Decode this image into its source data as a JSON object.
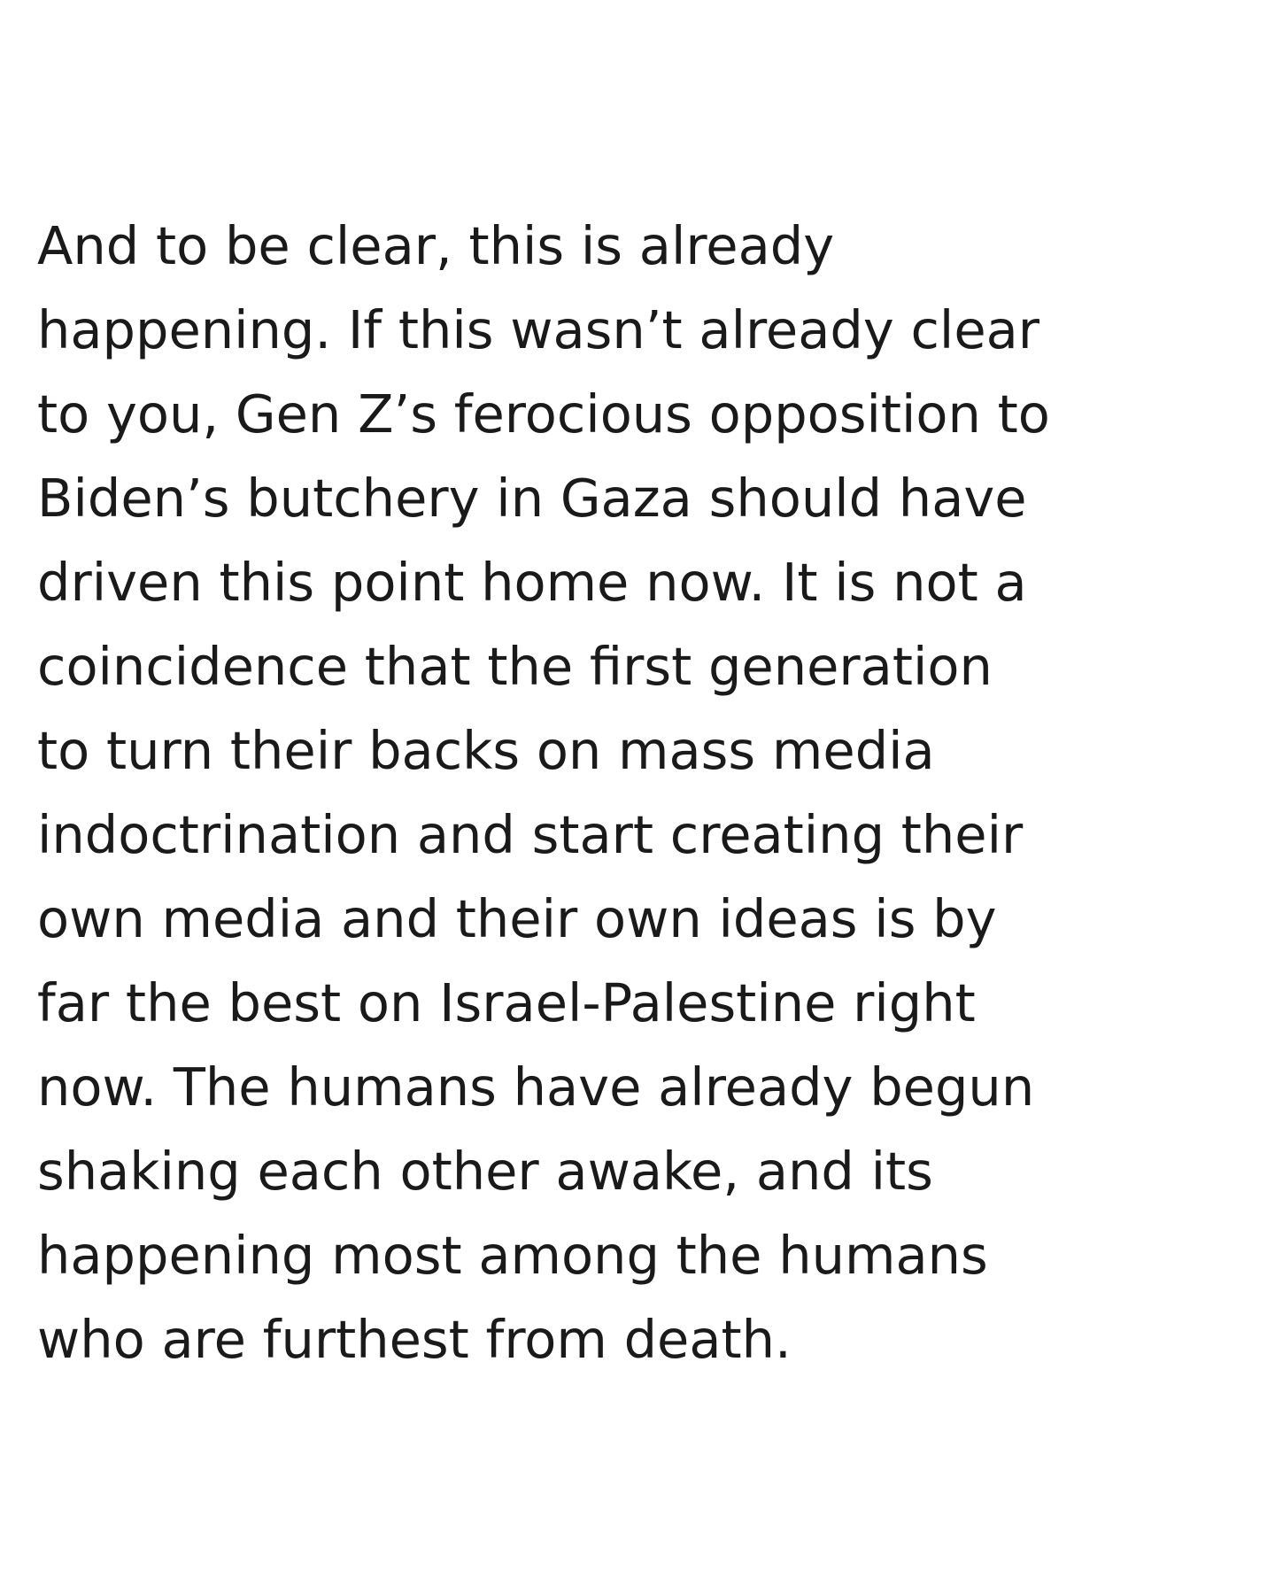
{
  "post": {
    "lines": [
      "And to be clear, this is already",
      "happening. If this wasn’t already clear",
      "to you, Gen Z’s ferocious opposition to",
      "Biden’s butchery in Gaza should have",
      "driven this point home now. It is not a",
      "coincidence that the first generation",
      "to turn their backs on mass media",
      "indoctrination and start creating their",
      "own media and their own ideas is by",
      "far the best on Israel-Palestine right",
      "now. The humans have already begun",
      "shaking each other awake, and its",
      "happening most among the humans",
      "who are furthest from death."
    ]
  },
  "colors": {
    "background": "#ffffff",
    "text": "#1a1a1a"
  }
}
